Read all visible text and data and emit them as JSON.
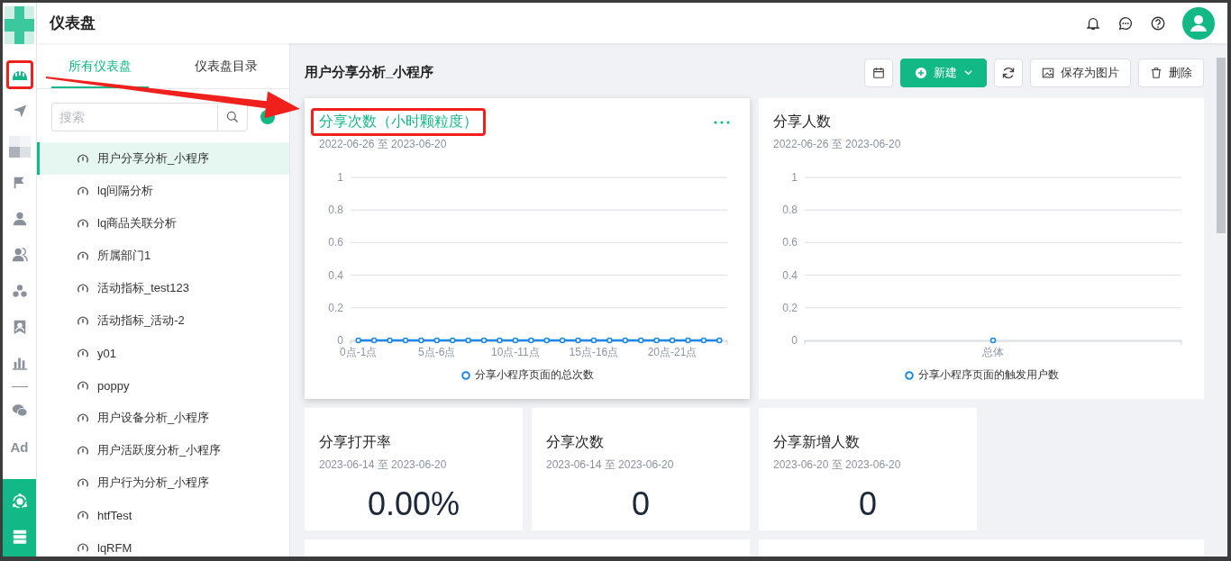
{
  "header": {
    "title": "仪表盘"
  },
  "annotation": {
    "arrow": true
  },
  "rail": {
    "top_items": [
      {
        "kind": "dashboard",
        "selected": true,
        "highlighted": true
      },
      {
        "kind": "send",
        "selected": false,
        "highlighted": false
      },
      {
        "kind": "blurred",
        "selected": false,
        "highlighted": false
      },
      {
        "kind": "flag",
        "selected": false,
        "highlighted": false
      },
      {
        "kind": "user",
        "selected": false,
        "highlighted": false
      },
      {
        "kind": "users",
        "selected": false,
        "highlighted": false
      },
      {
        "kind": "cluster",
        "selected": false,
        "highlighted": false
      },
      {
        "kind": "badge",
        "selected": false,
        "highlighted": false
      },
      {
        "kind": "bar-chart",
        "selected": false,
        "highlighted": false
      }
    ],
    "bottom_items": [
      {
        "kind": "wechat",
        "selected": false
      },
      {
        "kind": "text",
        "label": "Ad",
        "selected": false
      }
    ],
    "footer_items": [
      {
        "kind": "network"
      },
      {
        "kind": "server"
      }
    ]
  },
  "sidebar": {
    "tabs": [
      {
        "label": "所有仪表盘",
        "selected": true
      },
      {
        "label": "仪表盘目录",
        "selected": false
      }
    ],
    "search": {
      "placeholder": "搜索"
    },
    "items": [
      {
        "label": "用户分享分析_小程序",
        "selected": true
      },
      {
        "label": "lq间隔分析",
        "selected": false
      },
      {
        "label": "lq商品关联分析",
        "selected": false
      },
      {
        "label": "所属部门1",
        "selected": false
      },
      {
        "label": "活动指标_test123",
        "selected": false
      },
      {
        "label": "活动指标_活动-2",
        "selected": false
      },
      {
        "label": "y01",
        "selected": false
      },
      {
        "label": "poppy",
        "selected": false
      },
      {
        "label": "用户设备分析_小程序",
        "selected": false
      },
      {
        "label": "用户活跃度分析_小程序",
        "selected": false
      },
      {
        "label": "用户行为分析_小程序",
        "selected": false
      },
      {
        "label": "htfTest",
        "selected": false
      },
      {
        "label": "lqRFM",
        "selected": false
      }
    ]
  },
  "dashboard": {
    "title": "用户分享分析_小程序",
    "toolbar": [
      {
        "kind": "calendar"
      },
      {
        "kind": "primary",
        "label": "新建"
      },
      {
        "kind": "refresh"
      },
      {
        "kind": "image",
        "label": "保存为图片"
      },
      {
        "kind": "delete",
        "label": "删除"
      }
    ],
    "charts": [
      {
        "title": "分享次数（小时颗粒度）",
        "range": "2022-06-26 至 2023-06-20",
        "hovered": true,
        "highlighted": true,
        "chart_data": {
          "type": "line",
          "grid": true,
          "categories": [
            "0点-1点",
            null,
            null,
            null,
            null,
            "5点-6点",
            null,
            null,
            null,
            null,
            "10点-11点",
            null,
            null,
            null,
            null,
            "15点-16点",
            null,
            null,
            null,
            null,
            "20点-21点",
            null,
            null,
            null
          ],
          "ylim": [
            0,
            1
          ],
          "yticks": [
            0,
            0.2,
            0.4,
            0.6,
            0.8,
            1
          ],
          "series": [
            {
              "name": "分享小程序页面的总次数",
              "color": "#1e88e5",
              "marker": true,
              "values": [
                0,
                0,
                0,
                0,
                0,
                0,
                0,
                0,
                0,
                0,
                0,
                0,
                0,
                0,
                0,
                0,
                0,
                0,
                0,
                0,
                0,
                0,
                0,
                0
              ]
            }
          ]
        }
      },
      {
        "title": "分享人数",
        "range": "2022-06-26 至 2023-06-20",
        "hovered": false,
        "highlighted": false,
        "chart_data": {
          "type": "line",
          "grid": true,
          "categories": [
            "总体"
          ],
          "ylim": [
            0,
            1
          ],
          "yticks": [
            0,
            0.2,
            0.4,
            0.6,
            0.8,
            1
          ],
          "series": [
            {
              "name": "分享小程序页面的触发用户数",
              "color": "#1e88e5",
              "marker": true,
              "values": [
                0
              ]
            }
          ]
        }
      }
    ],
    "kpis": [
      {
        "title": "分享打开率",
        "range": "2023-06-14 至 2023-06-20",
        "value": "0.00%"
      },
      {
        "title": "分享次数",
        "range": "2023-06-14 至 2023-06-20",
        "value": "0"
      },
      {
        "title": "分享新增人数",
        "range": "2023-06-20 至 2023-06-20",
        "value": "0"
      }
    ]
  }
}
